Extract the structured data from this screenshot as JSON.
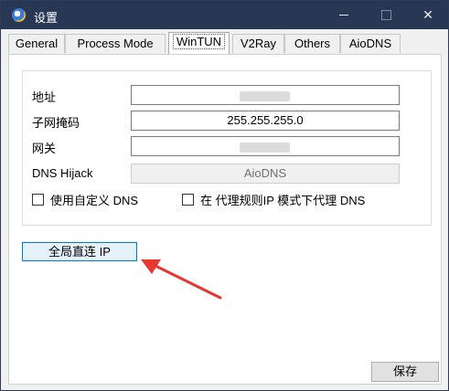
{
  "window": {
    "title": "设置",
    "minimize_icon": "minimize-icon",
    "maximize_icon": "maximize-icon",
    "close_glyph": "✕"
  },
  "tabs": [
    {
      "label": "General"
    },
    {
      "label": "Process Mode"
    },
    {
      "label": "WinTUN",
      "active": true
    },
    {
      "label": "V2Ray"
    },
    {
      "label": "Others"
    },
    {
      "label": "AioDNS"
    }
  ],
  "wintun": {
    "address_label": "地址",
    "address_value": "",
    "netmask_label": "子网掩码",
    "netmask_value": "255.255.255.0",
    "gateway_label": "网关",
    "gateway_value": "",
    "dns_hijack_label": "DNS Hijack",
    "dns_hijack_value": "AioDNS",
    "custom_dns_label": "使用自定义 DNS",
    "proxy_dns_label": "在 代理规则IP 模式下代理 DNS",
    "global_bypass_label": "全局直连 IP"
  },
  "footer": {
    "save_label": "保存"
  },
  "annotation": {
    "arrow_color": "#e8372e"
  }
}
